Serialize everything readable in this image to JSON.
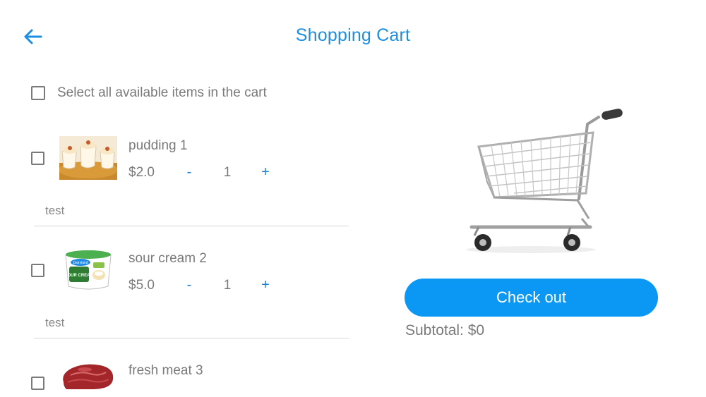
{
  "header": {
    "title": "Shopping Cart"
  },
  "select_all": {
    "label": "Select all available items in the cart",
    "checked": false
  },
  "items": [
    {
      "name": "pudding 1",
      "price": "$2.0",
      "minus": "-",
      "quantity": "1",
      "plus": "+",
      "note": "test",
      "checked": false
    },
    {
      "name": "sour cream 2",
      "price": "$5.0",
      "minus": "-",
      "quantity": "1",
      "plus": "+",
      "note": "test",
      "checked": false
    },
    {
      "name": "fresh meat 3",
      "checked": false
    }
  ],
  "checkout": {
    "button_label": "Check out",
    "subtotal": "Subtotal: $0"
  },
  "colors": {
    "accent": "#1a8fe3",
    "button": "#0a98f4",
    "text_gray": "#7a7a7a"
  },
  "icons": {
    "back": "arrow-left-icon",
    "cart": "shopping-cart-icon"
  },
  "thumb_text": {
    "sour_cream_brand": "Dairyland",
    "sour_cream_label": "SOUR CREAM"
  }
}
